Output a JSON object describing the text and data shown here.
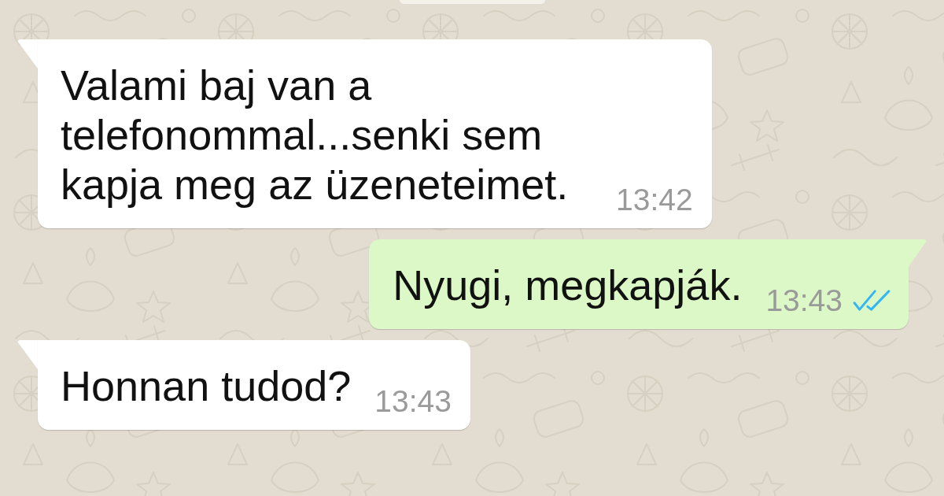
{
  "messages": [
    {
      "kind": "incoming",
      "text": "Valami baj van a telefonommal...senki sem kapja meg az üzeneteimet.",
      "time": "13:42"
    },
    {
      "kind": "outgoing",
      "text": "Nyugi, megkapják.",
      "time": "13:43",
      "read": true
    },
    {
      "kind": "incoming",
      "text": "Honnan tudod?",
      "time": "13:43"
    }
  ]
}
